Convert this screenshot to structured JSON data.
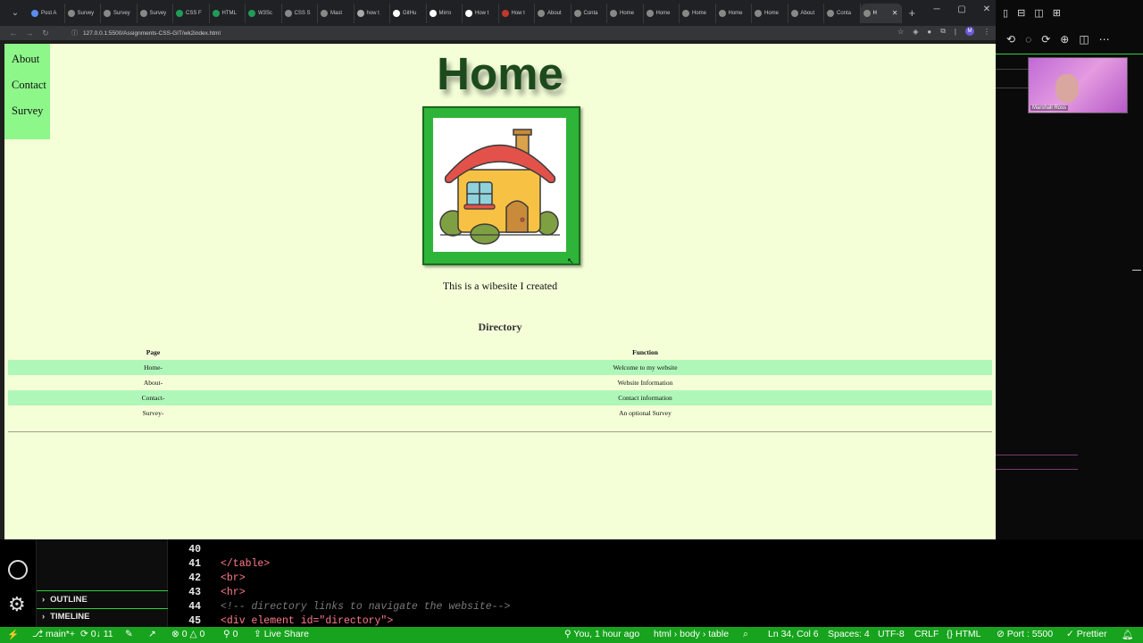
{
  "browser": {
    "tabs": [
      {
        "label": "Post A"
      },
      {
        "label": "Survey"
      },
      {
        "label": "Survey"
      },
      {
        "label": "Survey"
      },
      {
        "label": "CSS F"
      },
      {
        "label": "HTML"
      },
      {
        "label": "W3Sc"
      },
      {
        "label": "CSS S"
      },
      {
        "label": "Mast"
      },
      {
        "label": "how t"
      },
      {
        "label": "GitHu"
      },
      {
        "label": "Mirro"
      },
      {
        "label": "How t"
      },
      {
        "label": "How t"
      },
      {
        "label": "About"
      },
      {
        "label": "Conta"
      },
      {
        "label": "Home"
      },
      {
        "label": "Home"
      },
      {
        "label": "Home"
      },
      {
        "label": "Home"
      },
      {
        "label": "Home"
      },
      {
        "label": "About"
      },
      {
        "label": "Conta"
      },
      {
        "label": "H"
      }
    ],
    "new_tab": "+",
    "url": "127.0.0.1:5500/Assignments-CSS-GIT/wk2index.html",
    "profile_initial": "M"
  },
  "page": {
    "nav": [
      {
        "label": "About"
      },
      {
        "label": "Contact"
      },
      {
        "label": "Survey"
      }
    ],
    "title": "Home",
    "tagline": "This is a wibesite I created",
    "directory_title": "Directory",
    "table": {
      "headers": [
        "Page",
        "Function"
      ],
      "rows": [
        [
          "Home-",
          "Welcome to my website"
        ],
        [
          "About-",
          "Website Information"
        ],
        [
          "Contact-",
          "Contact information"
        ],
        [
          "Survey-",
          "An optional Survey"
        ]
      ]
    }
  },
  "webcam": {
    "name": "Marshall Ross"
  },
  "vscode": {
    "explorer_sections": [
      "OUTLINE",
      "TIMELINE"
    ],
    "lines": [
      {
        "n": "40",
        "code": ""
      },
      {
        "n": "41",
        "code": "</table>"
      },
      {
        "n": "42",
        "code": "<br>"
      },
      {
        "n": "43",
        "code": "<hr>"
      },
      {
        "n": "44",
        "code": "<!-- directory links to navigate the website-->"
      },
      {
        "n": "45",
        "code": "<div element id=\"directory\">"
      }
    ],
    "status": {
      "branch": "main*+",
      "sync": "0↓ 11",
      "problems": "0 △ 0",
      "ports": "0",
      "live_share": "Live Share",
      "blame": "You, 1 hour ago",
      "breadcrumb": "html › body › table",
      "position": "Ln 34, Col 6",
      "spaces": "Spaces: 4",
      "encoding": "UTF-8",
      "eol": "CRLF",
      "language": "HTML",
      "port": "Port : 5500",
      "formatter": "Prettier"
    }
  },
  "colors": {
    "page_bg": "#f4ffd8",
    "nav_bg": "#8ef78a",
    "row_alt": "#aff7b9",
    "frame": "#2fb43a",
    "status_bar": "#17a31d"
  }
}
